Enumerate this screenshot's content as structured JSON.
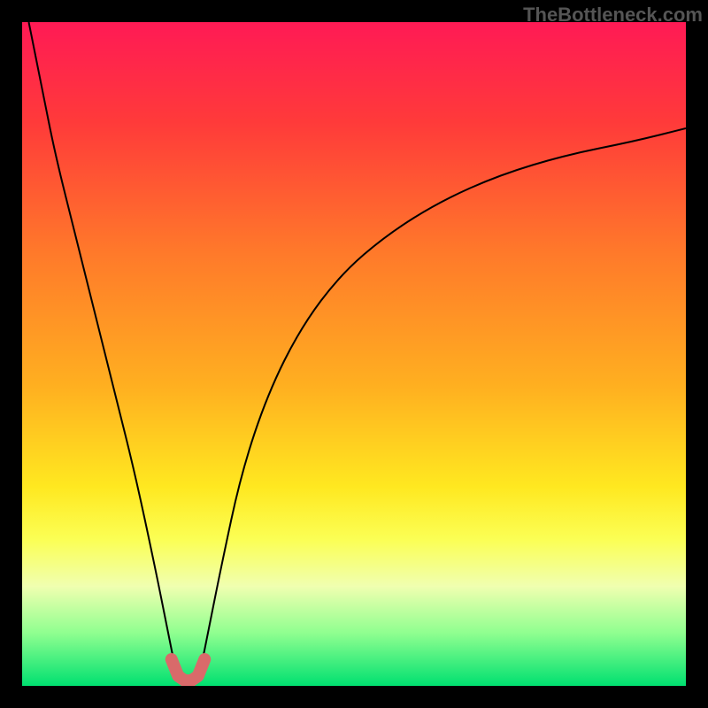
{
  "watermark": "TheBottleneck.com",
  "chart_data": {
    "type": "line",
    "title": "",
    "xlabel": "",
    "ylabel": "",
    "xlim": [
      0,
      100
    ],
    "ylim": [
      0,
      100
    ],
    "gradient_background": {
      "stops": [
        {
          "offset": 0,
          "color": "#ff1a55"
        },
        {
          "offset": 15,
          "color": "#ff3a3a"
        },
        {
          "offset": 35,
          "color": "#ff7a2a"
        },
        {
          "offset": 55,
          "color": "#ffb020"
        },
        {
          "offset": 70,
          "color": "#ffe820"
        },
        {
          "offset": 78,
          "color": "#fbff55"
        },
        {
          "offset": 85,
          "color": "#f0ffb0"
        },
        {
          "offset": 92,
          "color": "#90ff90"
        },
        {
          "offset": 100,
          "color": "#00e070"
        }
      ]
    },
    "series": [
      {
        "name": "bottleneck-curve",
        "color": "#000000",
        "x": [
          1,
          3,
          5,
          8,
          11,
          14,
          17,
          20,
          22,
          23,
          24,
          25,
          26,
          27,
          28,
          30,
          33,
          37,
          42,
          48,
          55,
          63,
          72,
          82,
          92,
          100
        ],
        "y": [
          100,
          90,
          80,
          68,
          56,
          44,
          32,
          18,
          8,
          3,
          1,
          0.5,
          1,
          3,
          8,
          18,
          32,
          44,
          54,
          62,
          68,
          73,
          77,
          80,
          82,
          84
        ]
      },
      {
        "name": "minimum-marker",
        "color": "#d96a6a",
        "type": "marker-path",
        "x": [
          22.5,
          23.5,
          24.5,
          25.5,
          26.5,
          27.5
        ],
        "y": [
          4,
          1.5,
          0.8,
          0.8,
          1.5,
          4
        ]
      }
    ],
    "minimum_point": {
      "x": 25,
      "y": 0.5
    }
  }
}
